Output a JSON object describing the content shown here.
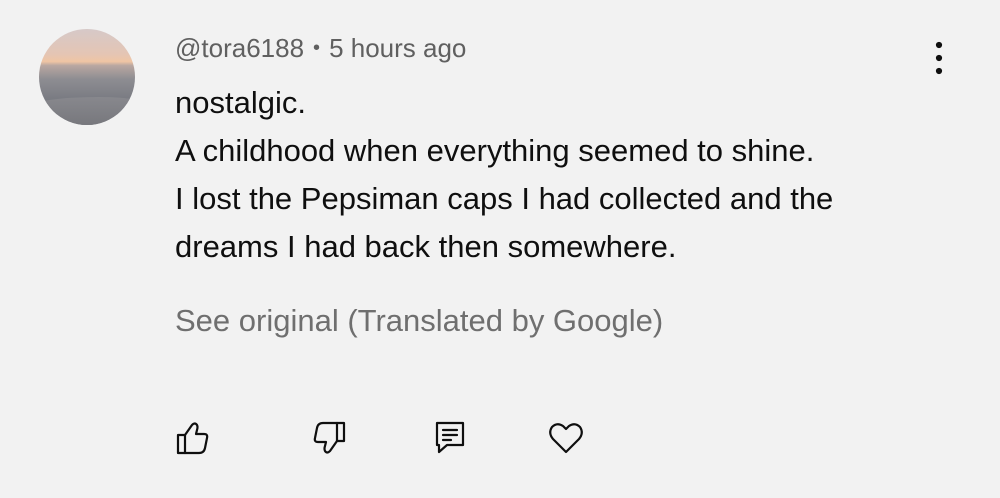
{
  "comment": {
    "author": "@tora6188",
    "separator": "•",
    "timestamp": "5 hours ago",
    "lines": [
      "nostalgic.",
      "A childhood when everything seemed to shine.",
      "I lost the Pepsiman caps I had collected and the",
      "dreams I had back then somewhere."
    ],
    "translation_link": "See original (Translated by Google)"
  },
  "icons": {
    "avatar": "avatar-sunset-sea",
    "menu": "more-vertical-icon",
    "like": "thumbs-up-icon",
    "dislike": "thumbs-down-icon",
    "reply": "reply-comment-icon",
    "heart": "heart-icon"
  },
  "colors": {
    "background": "#f2f2f2",
    "text_primary": "#0f0f0f",
    "text_secondary": "#606060",
    "icon": "#0f0f0f"
  }
}
